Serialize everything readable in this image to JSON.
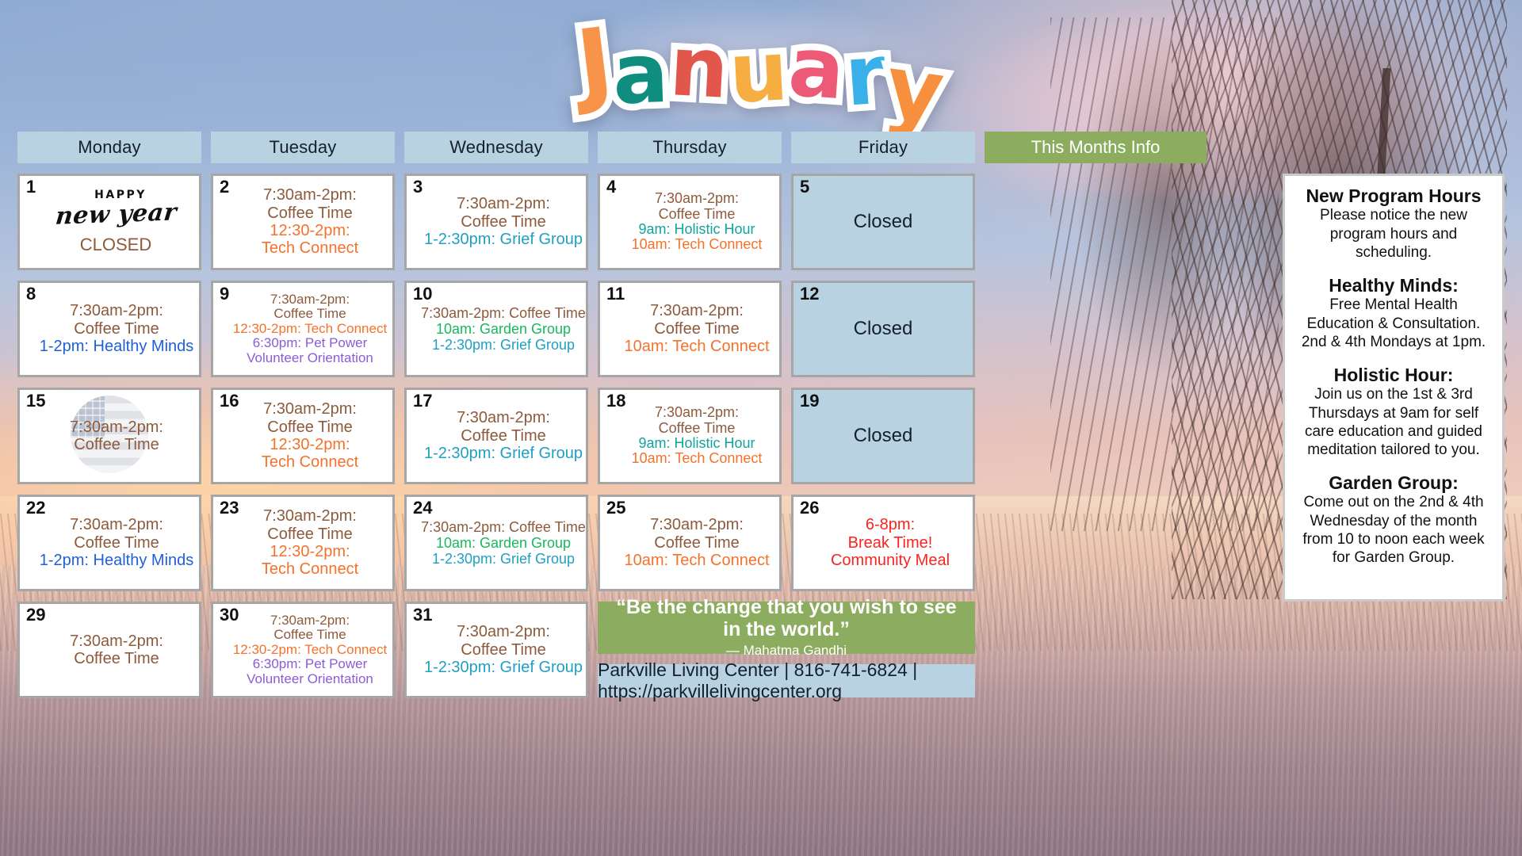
{
  "title": {
    "text": "January",
    "letters": [
      {
        "ch": "J",
        "color": "#f79449"
      },
      {
        "ch": "a",
        "color": "#0f8e80"
      },
      {
        "ch": "n",
        "color": "#e1574c"
      },
      {
        "ch": "u",
        "color": "#f6ae42"
      },
      {
        "ch": "a",
        "color": "#ec5a77"
      },
      {
        "ch": "r",
        "color": "#3ab0e8"
      },
      {
        "ch": "y",
        "color": "#f6903e"
      }
    ]
  },
  "headers": {
    "monday": "Monday",
    "tuesday": "Tuesday",
    "wednesday": "Wednesday",
    "thursday": "Thursday",
    "friday": "Friday",
    "info": "This Months Info"
  },
  "colors": {
    "day_header_bg": "#b8d2e2",
    "info_header_bg": "#8cad5f",
    "closed_cell_bg": "#b8d2e2",
    "coffee_time": "#8d5a3c",
    "tech_connect": "#f4722b",
    "grief_group": "#1f9fc4",
    "healthy_minds": "#1f5fd8",
    "holistic_hour": "#11a39c",
    "garden_group": "#17b85e",
    "pet_power": "#8a5cd6",
    "break_time": "#f8251f"
  },
  "week1": {
    "d1": {
      "num": "1",
      "happy": "HAPPY",
      "script": "new year",
      "closed": "CLOSED"
    },
    "d2": {
      "num": "2",
      "events": [
        {
          "text": "7:30am-2pm:",
          "color": "#8d5a3c"
        },
        {
          "text": "Coffee Time",
          "color": "#8d5a3c"
        },
        {
          "text": "12:30-2pm:",
          "color": "#f4722b"
        },
        {
          "text": "Tech Connect",
          "color": "#f4722b"
        }
      ]
    },
    "d3": {
      "num": "3",
      "events": [
        {
          "text": "7:30am-2pm:",
          "color": "#8d5a3c"
        },
        {
          "text": "Coffee Time",
          "color": "#8d5a3c"
        },
        {
          "text": "1-2:30pm: Grief Group",
          "color": "#1f9fc4"
        }
      ]
    },
    "d4": {
      "num": "4",
      "events": [
        {
          "text": "7:30am-2pm:",
          "color": "#8d5a3c"
        },
        {
          "text": "Coffee Time",
          "color": "#8d5a3c"
        },
        {
          "text": "9am: Holistic Hour",
          "color": "#11a39c"
        },
        {
          "text": "10am: Tech Connect",
          "color": "#f4722b"
        }
      ]
    },
    "d5": {
      "num": "5",
      "label": "Closed"
    }
  },
  "week2": {
    "d8": {
      "num": "8",
      "events": [
        {
          "text": "7:30am-2pm:",
          "color": "#8d5a3c"
        },
        {
          "text": "Coffee Time",
          "color": "#8d5a3c"
        },
        {
          "text": "1-2pm: Healthy Minds",
          "color": "#1f5fd8"
        }
      ]
    },
    "d9": {
      "num": "9",
      "events": [
        {
          "text": "7:30am-2pm:",
          "color": "#8d5a3c"
        },
        {
          "text": "Coffee Time",
          "color": "#8d5a3c"
        },
        {
          "text": "12:30-2pm: Tech Connect",
          "color": "#f4722b"
        },
        {
          "text": "6:30pm: Pet Power",
          "color": "#8a5cd6"
        },
        {
          "text": "Volunteer Orientation",
          "color": "#8a5cd6"
        }
      ]
    },
    "d10": {
      "num": "10",
      "events": [
        {
          "text": "7:30am-2pm: Coffee Time",
          "color": "#8d5a3c"
        },
        {
          "text": "10am: Garden Group",
          "color": "#17b85e"
        },
        {
          "text": "1-2:30pm: Grief Group",
          "color": "#1f9fc4"
        }
      ]
    },
    "d11": {
      "num": "11",
      "events": [
        {
          "text": "7:30am-2pm:",
          "color": "#8d5a3c"
        },
        {
          "text": "Coffee Time",
          "color": "#8d5a3c"
        },
        {
          "text": "10am: Tech Connect",
          "color": "#f4722b"
        }
      ]
    },
    "d12": {
      "num": "12",
      "label": "Closed"
    }
  },
  "week3": {
    "d15": {
      "num": "15",
      "events": [
        {
          "text": "7:30am-2pm:",
          "color": "#8d5a3c"
        },
        {
          "text": "Coffee Time",
          "color": "#8d5a3c"
        }
      ],
      "badge": "us-flag-circle"
    },
    "d16": {
      "num": "16",
      "events": [
        {
          "text": "7:30am-2pm:",
          "color": "#8d5a3c"
        },
        {
          "text": "Coffee Time",
          "color": "#8d5a3c"
        },
        {
          "text": "12:30-2pm:",
          "color": "#f4722b"
        },
        {
          "text": "Tech Connect",
          "color": "#f4722b"
        }
      ]
    },
    "d17": {
      "num": "17",
      "events": [
        {
          "text": "7:30am-2pm:",
          "color": "#8d5a3c"
        },
        {
          "text": "Coffee Time",
          "color": "#8d5a3c"
        },
        {
          "text": "1-2:30pm: Grief Group",
          "color": "#1f9fc4"
        }
      ]
    },
    "d18": {
      "num": "18",
      "events": [
        {
          "text": "7:30am-2pm:",
          "color": "#8d5a3c"
        },
        {
          "text": "Coffee Time",
          "color": "#8d5a3c"
        },
        {
          "text": "9am: Holistic Hour",
          "color": "#11a39c"
        },
        {
          "text": "10am: Tech Connect",
          "color": "#f4722b"
        }
      ]
    },
    "d19": {
      "num": "19",
      "label": "Closed"
    }
  },
  "week4": {
    "d22": {
      "num": "22",
      "events": [
        {
          "text": "7:30am-2pm:",
          "color": "#8d5a3c"
        },
        {
          "text": "Coffee Time",
          "color": "#8d5a3c"
        },
        {
          "text": "1-2pm: Healthy Minds",
          "color": "#1f5fd8"
        }
      ]
    },
    "d23": {
      "num": "23",
      "events": [
        {
          "text": "7:30am-2pm:",
          "color": "#8d5a3c"
        },
        {
          "text": "Coffee Time",
          "color": "#8d5a3c"
        },
        {
          "text": "12:30-2pm:",
          "color": "#f4722b"
        },
        {
          "text": "Tech Connect",
          "color": "#f4722b"
        }
      ]
    },
    "d24": {
      "num": "24",
      "events": [
        {
          "text": "7:30am-2pm: Coffee Time",
          "color": "#8d5a3c"
        },
        {
          "text": "10am: Garden Group",
          "color": "#17b85e"
        },
        {
          "text": "1-2:30pm: Grief Group",
          "color": "#1f9fc4"
        }
      ]
    },
    "d25": {
      "num": "25",
      "events": [
        {
          "text": "7:30am-2pm:",
          "color": "#8d5a3c"
        },
        {
          "text": "Coffee Time",
          "color": "#8d5a3c"
        },
        {
          "text": "10am: Tech Connect",
          "color": "#f4722b"
        }
      ]
    },
    "d26": {
      "num": "26",
      "events": [
        {
          "text": "6-8pm:",
          "color": "#f8251f"
        },
        {
          "text": "Break Time!",
          "color": "#f8251f"
        },
        {
          "text": "Community Meal",
          "color": "#f8251f"
        }
      ]
    }
  },
  "week5": {
    "d29": {
      "num": "29",
      "events": [
        {
          "text": "7:30am-2pm:",
          "color": "#8d5a3c"
        },
        {
          "text": "Coffee Time",
          "color": "#8d5a3c"
        }
      ]
    },
    "d30": {
      "num": "30",
      "events": [
        {
          "text": "7:30am-2pm:",
          "color": "#8d5a3c"
        },
        {
          "text": "Coffee Time",
          "color": "#8d5a3c"
        },
        {
          "text": "12:30-2pm: Tech Connect",
          "color": "#f4722b"
        },
        {
          "text": "6:30pm: Pet Power",
          "color": "#8a5cd6"
        },
        {
          "text": "Volunteer Orientation",
          "color": "#8a5cd6"
        }
      ]
    },
    "d31": {
      "num": "31",
      "events": [
        {
          "text": "7:30am-2pm:",
          "color": "#8d5a3c"
        },
        {
          "text": "Coffee Time",
          "color": "#8d5a3c"
        },
        {
          "text": "1-2:30pm: Grief Group",
          "color": "#1f9fc4"
        }
      ]
    }
  },
  "quote": {
    "text": "“Be the change that you wish to see in the world.”",
    "author": "— Mahatma Gandhi"
  },
  "footer": {
    "text": "Parkville Living Center | 816-741-6824 | https://parkvillelivingcenter.org"
  },
  "info": {
    "blocks": [
      {
        "title": "New Program Hours",
        "body": "Please notice the new program hours and scheduling."
      },
      {
        "title": "Healthy Minds:",
        "body": "Free Mental Health Education & Consultation. 2nd & 4th Mondays at 1pm."
      },
      {
        "title": "Holistic Hour:",
        "body": "Join us on the 1st & 3rd Thursdays at 9am for self care education and guided meditation tailored to you."
      },
      {
        "title": "Garden Group:",
        "body": "Come out on the 2nd & 4th Wednesday of the month from 10 to noon each week for Garden Group."
      }
    ]
  }
}
